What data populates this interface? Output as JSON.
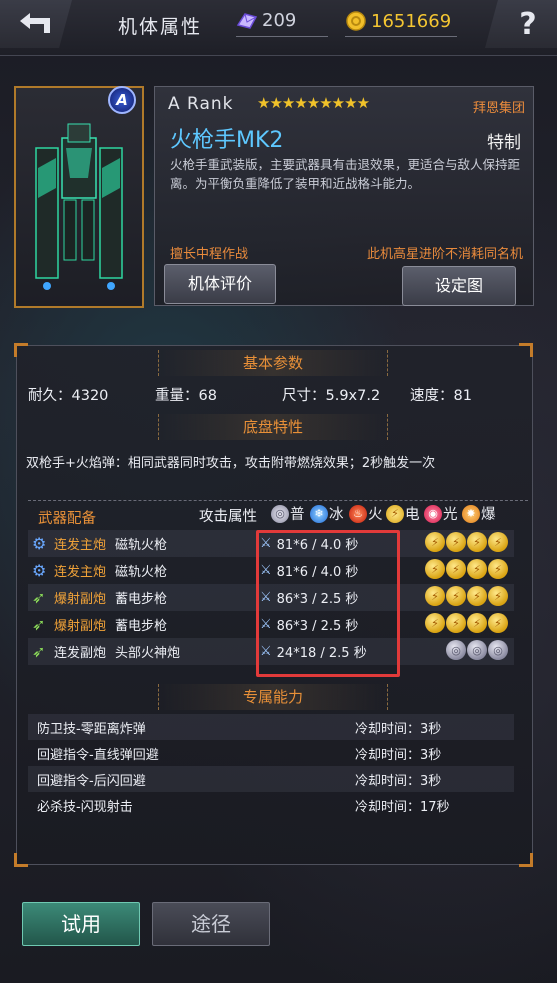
{
  "header": {
    "title": "机体属性",
    "crystal_count": "209",
    "gold_count": "1651669",
    "help_label": "?"
  },
  "mech": {
    "rank_badge": "A",
    "rank": "A  Rank",
    "stars": "★★★★★★★★★",
    "maker": "拜恩集团",
    "name": "火枪手MK2",
    "type": "特制",
    "description": "火枪手重武装版，主要武器具有击退效果，更适合与敌人保持距离。为平衡负重降低了装甲和近战格斗能力。",
    "tag_left": "擅长中程作战",
    "tag_right": "此机高星进阶不消耗同名机",
    "eval_button": "机体评价",
    "config_button": "设定图"
  },
  "basic": {
    "title": "基本参数",
    "durability": "耐久：4320",
    "weight": "重量：68",
    "size": "尺寸：5.9x7.2",
    "speed": "速度：81"
  },
  "chassis": {
    "title": "底盘特性",
    "text": "双枪手+火焰弹：相同武器同时攻击，攻击附带燃烧效果；2秒触发一次"
  },
  "weapons": {
    "title": "武器配备",
    "attr_label": "攻击属性",
    "elements": [
      {
        "label": "普",
        "color": "#c8c8d8"
      },
      {
        "label": "冰",
        "color": "#4aa6ff"
      },
      {
        "label": "火",
        "color": "#ff4a2a"
      },
      {
        "label": "电",
        "color": "#ffd23a"
      },
      {
        "label": "光",
        "color": "#ff4a7a"
      },
      {
        "label": "爆",
        "color": "#ff9a2a"
      }
    ],
    "rows": [
      {
        "type": "连发主炮",
        "name": "磁轨火枪",
        "stat": "81*6 / 4.0 秒",
        "type_color": "#f0a238",
        "icon_color": "#6aa8ff",
        "coins": "yyyy"
      },
      {
        "type": "连发主炮",
        "name": "磁轨火枪",
        "stat": "81*6 / 4.0 秒",
        "type_color": "#f0a238",
        "icon_color": "#6aa8ff",
        "coins": "yyyy"
      },
      {
        "type": "爆射副炮",
        "name": "蓄电步枪",
        "stat": "86*3 / 2.5 秒",
        "type_color": "#f0a238",
        "icon_color": "#8ee05a",
        "coins": "yyyy"
      },
      {
        "type": "爆射副炮",
        "name": "蓄电步枪",
        "stat": "86*3 / 2.5 秒",
        "type_color": "#f0a238",
        "icon_color": "#8ee05a",
        "coins": "yyyy"
      },
      {
        "type": "连发副炮",
        "name": "头部火神炮",
        "stat": "24*18 / 2.5 秒",
        "type_color": "#eceef4",
        "icon_color": "#8ee05a",
        "coins": "www"
      }
    ]
  },
  "skills": {
    "title": "专属能力",
    "rows": [
      {
        "name": "防卫技-零距离炸弹",
        "cd": "冷却时间：3秒"
      },
      {
        "name": "回避指令-直线弹回避",
        "cd": "冷却时间：3秒"
      },
      {
        "name": "回避指令-后闪回避",
        "cd": "冷却时间：3秒"
      },
      {
        "name": "必杀技-闪现射击",
        "cd": "冷却时间：17秒"
      }
    ]
  },
  "footer": {
    "try_label": "试用",
    "path_label": "途径"
  }
}
